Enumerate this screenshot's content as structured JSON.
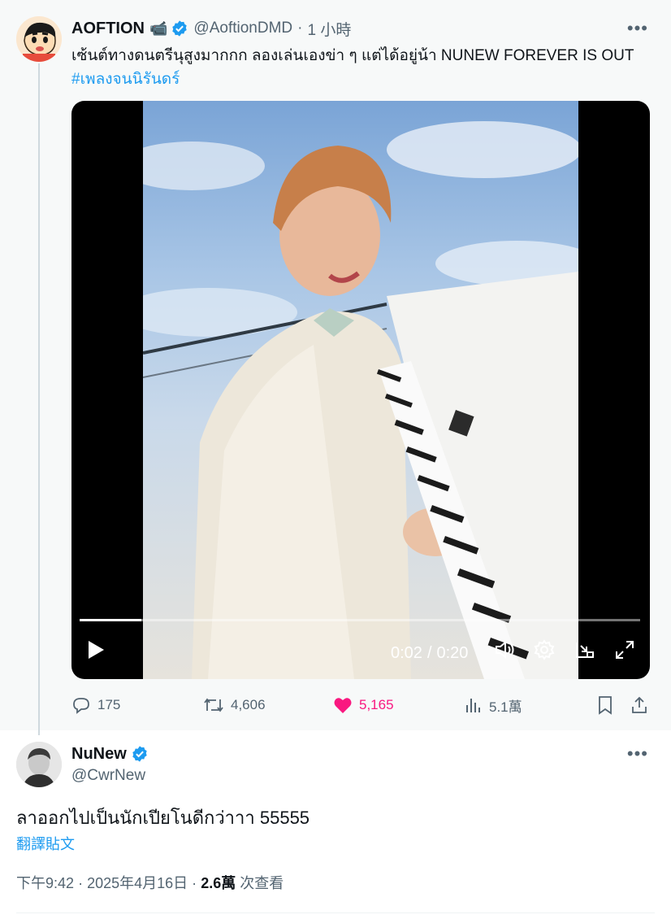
{
  "quoted_post": {
    "author_name": "AOFTION",
    "author_emoji": "📹",
    "handle": "@AoftionDMD",
    "separator": "·",
    "time": "1 小時",
    "text": "เซ้นต์ทางดนตรีนุสูงมากกก ลองเล่นเองข่า ๆ แต่ได้อยู่น้า NUNEW FOREVER IS OUT",
    "hashtag": "#เพลงจนนิรันดร์",
    "video": {
      "current_time": "0:02",
      "separator": "/",
      "duration": "0:20",
      "progress": 0.11
    },
    "actions": {
      "replies": "175",
      "reposts": "4,606",
      "likes": "5,165",
      "views": "5.1萬"
    }
  },
  "reply_post": {
    "author_name": "NuNew",
    "handle": "@CwrNew",
    "text": "ลาออกไปเป็นนักเปียโนดีกว่าาา 55555",
    "translate_label": "翻譯貼文",
    "time": "下午9:42",
    "dot": "·",
    "date": "2025年4月16日",
    "views_count": "2.6萬",
    "views_label": "次查看"
  },
  "icons": [
    "verified-badge-icon",
    "more-icon",
    "reply-icon",
    "repost-icon",
    "like-icon",
    "views-icon",
    "bookmark-icon",
    "share-icon",
    "play-icon",
    "volume-icon",
    "settings-icon",
    "pip-icon",
    "fullscreen-icon"
  ],
  "colors": {
    "accent": "#1d9bf0",
    "like": "#f91880",
    "secondary_text": "#536471"
  }
}
